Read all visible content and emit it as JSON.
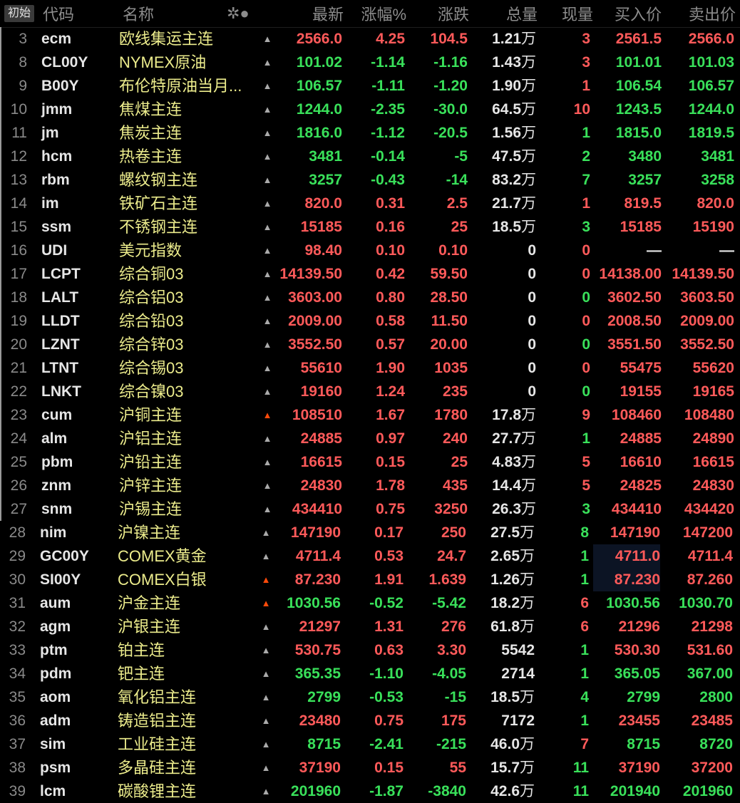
{
  "toolbar": {
    "init_label": "初始",
    "sort_icon": "✲●"
  },
  "header": {
    "code": "代码",
    "name": "名称",
    "last": "最新",
    "pct": "涨幅%",
    "chg": "涨跌",
    "vol": "总量",
    "cur": "现量",
    "bid": "买入价",
    "ask": "卖出价"
  },
  "colors": {
    "up": "#ff5a5a",
    "down": "#39e05a",
    "name": "#ecec8c",
    "alert": "#ff4a0a"
  },
  "rows": [
    {
      "idx": "3",
      "code": "ecm",
      "name": "欧线集运主连",
      "bell": "normal",
      "last": "2566.0",
      "pct": "4.25",
      "chg": "104.5",
      "vol": "1.21",
      "vol_unit": "万",
      "cur": "3",
      "bid": "2561.5",
      "ask": "2566.0",
      "tone": "up",
      "cur_tone": "up",
      "bid_tone": "up",
      "ask_tone": "up"
    },
    {
      "idx": "8",
      "code": "CL00Y",
      "name": "NYMEX原油",
      "bell": "normal",
      "last": "101.02",
      "pct": "-1.14",
      "chg": "-1.16",
      "vol": "1.43",
      "vol_unit": "万",
      "cur": "3",
      "bid": "101.01",
      "ask": "101.03",
      "tone": "down",
      "cur_tone": "up",
      "bid_tone": "down",
      "ask_tone": "down"
    },
    {
      "idx": "9",
      "code": "B00Y",
      "name": "布伦特原油当月...",
      "bell": "normal",
      "last": "106.57",
      "pct": "-1.11",
      "chg": "-1.20",
      "vol": "1.90",
      "vol_unit": "万",
      "cur": "1",
      "bid": "106.54",
      "ask": "106.57",
      "tone": "down",
      "cur_tone": "up",
      "bid_tone": "down",
      "ask_tone": "down"
    },
    {
      "idx": "10",
      "code": "jmm",
      "name": "焦煤主连",
      "bell": "normal",
      "last": "1244.0",
      "pct": "-2.35",
      "chg": "-30.0",
      "vol": "64.5",
      "vol_unit": "万",
      "cur": "10",
      "bid": "1243.5",
      "ask": "1244.0",
      "tone": "down",
      "cur_tone": "up",
      "bid_tone": "down",
      "ask_tone": "down"
    },
    {
      "idx": "11",
      "code": "jm",
      "name": "焦炭主连",
      "bell": "normal",
      "last": "1816.0",
      "pct": "-1.12",
      "chg": "-20.5",
      "vol": "1.56",
      "vol_unit": "万",
      "cur": "1",
      "bid": "1815.0",
      "ask": "1819.5",
      "tone": "down",
      "cur_tone": "down",
      "bid_tone": "down",
      "ask_tone": "down"
    },
    {
      "idx": "12",
      "code": "hcm",
      "name": "热卷主连",
      "bell": "normal",
      "last": "3481",
      "pct": "-0.14",
      "chg": "-5",
      "vol": "47.5",
      "vol_unit": "万",
      "cur": "2",
      "bid": "3480",
      "ask": "3481",
      "tone": "down",
      "cur_tone": "down",
      "bid_tone": "down",
      "ask_tone": "down"
    },
    {
      "idx": "13",
      "code": "rbm",
      "name": "螺纹钢主连",
      "bell": "normal",
      "last": "3257",
      "pct": "-0.43",
      "chg": "-14",
      "vol": "83.2",
      "vol_unit": "万",
      "cur": "7",
      "bid": "3257",
      "ask": "3258",
      "tone": "down",
      "cur_tone": "down",
      "bid_tone": "down",
      "ask_tone": "down"
    },
    {
      "idx": "14",
      "code": "im",
      "name": "铁矿石主连",
      "bell": "normal",
      "last": "820.0",
      "pct": "0.31",
      "chg": "2.5",
      "vol": "21.7",
      "vol_unit": "万",
      "cur": "1",
      "bid": "819.5",
      "ask": "820.0",
      "tone": "up",
      "cur_tone": "up",
      "bid_tone": "up",
      "ask_tone": "up"
    },
    {
      "idx": "15",
      "code": "ssm",
      "name": "不锈钢主连",
      "bell": "normal",
      "last": "15185",
      "pct": "0.16",
      "chg": "25",
      "vol": "18.5",
      "vol_unit": "万",
      "cur": "3",
      "bid": "15185",
      "ask": "15190",
      "tone": "up",
      "cur_tone": "down",
      "bid_tone": "up",
      "ask_tone": "up"
    },
    {
      "idx": "16",
      "code": "UDI",
      "name": "美元指数",
      "bell": "normal",
      "last": "98.40",
      "pct": "0.10",
      "chg": "0.10",
      "vol": "0",
      "vol_unit": "",
      "cur": "0",
      "bid": "—",
      "ask": "—",
      "tone": "up",
      "cur_tone": "up",
      "bid_tone": "flat",
      "ask_tone": "flat"
    },
    {
      "idx": "17",
      "code": "LCPT",
      "name": "综合铜03",
      "bell": "normal",
      "last": "14139.50",
      "pct": "0.42",
      "chg": "59.50",
      "vol": "0",
      "vol_unit": "",
      "cur": "0",
      "bid": "14138.00",
      "ask": "14139.50",
      "tone": "up",
      "cur_tone": "up",
      "bid_tone": "up",
      "ask_tone": "up"
    },
    {
      "idx": "18",
      "code": "LALT",
      "name": "综合铝03",
      "bell": "normal",
      "last": "3603.00",
      "pct": "0.80",
      "chg": "28.50",
      "vol": "0",
      "vol_unit": "",
      "cur": "0",
      "bid": "3602.50",
      "ask": "3603.50",
      "tone": "up",
      "cur_tone": "down",
      "bid_tone": "up",
      "ask_tone": "up"
    },
    {
      "idx": "19",
      "code": "LLDT",
      "name": "综合铅03",
      "bell": "normal",
      "last": "2009.00",
      "pct": "0.58",
      "chg": "11.50",
      "vol": "0",
      "vol_unit": "",
      "cur": "0",
      "bid": "2008.50",
      "ask": "2009.00",
      "tone": "up",
      "cur_tone": "up",
      "bid_tone": "up",
      "ask_tone": "up"
    },
    {
      "idx": "20",
      "code": "LZNT",
      "name": "综合锌03",
      "bell": "normal",
      "last": "3552.50",
      "pct": "0.57",
      "chg": "20.00",
      "vol": "0",
      "vol_unit": "",
      "cur": "0",
      "bid": "3551.50",
      "ask": "3552.50",
      "tone": "up",
      "cur_tone": "down",
      "bid_tone": "up",
      "ask_tone": "up"
    },
    {
      "idx": "21",
      "code": "LTNT",
      "name": "综合锡03",
      "bell": "normal",
      "last": "55610",
      "pct": "1.90",
      "chg": "1035",
      "vol": "0",
      "vol_unit": "",
      "cur": "0",
      "bid": "55475",
      "ask": "55620",
      "tone": "up",
      "cur_tone": "up",
      "bid_tone": "up",
      "ask_tone": "up"
    },
    {
      "idx": "22",
      "code": "LNKT",
      "name": "综合镍03",
      "bell": "normal",
      "last": "19160",
      "pct": "1.24",
      "chg": "235",
      "vol": "0",
      "vol_unit": "",
      "cur": "0",
      "bid": "19155",
      "ask": "19165",
      "tone": "up",
      "cur_tone": "down",
      "bid_tone": "up",
      "ask_tone": "up"
    },
    {
      "idx": "23",
      "code": "cum",
      "name": "沪铜主连",
      "bell": "active",
      "last": "108510",
      "pct": "1.67",
      "chg": "1780",
      "vol": "17.8",
      "vol_unit": "万",
      "cur": "9",
      "bid": "108460",
      "ask": "108480",
      "tone": "up",
      "cur_tone": "up",
      "bid_tone": "up",
      "ask_tone": "up"
    },
    {
      "idx": "24",
      "code": "alm",
      "name": "沪铝主连",
      "bell": "normal",
      "last": "24885",
      "pct": "0.97",
      "chg": "240",
      "vol": "27.7",
      "vol_unit": "万",
      "cur": "1",
      "bid": "24885",
      "ask": "24890",
      "tone": "up",
      "cur_tone": "down",
      "bid_tone": "up",
      "ask_tone": "up"
    },
    {
      "idx": "25",
      "code": "pbm",
      "name": "沪铅主连",
      "bell": "normal",
      "last": "16615",
      "pct": "0.15",
      "chg": "25",
      "vol": "4.83",
      "vol_unit": "万",
      "cur": "5",
      "bid": "16610",
      "ask": "16615",
      "tone": "up",
      "cur_tone": "up",
      "bid_tone": "up",
      "ask_tone": "up"
    },
    {
      "idx": "26",
      "code": "znm",
      "name": "沪锌主连",
      "bell": "normal",
      "last": "24830",
      "pct": "1.78",
      "chg": "435",
      "vol": "14.4",
      "vol_unit": "万",
      "cur": "5",
      "bid": "24825",
      "ask": "24830",
      "tone": "up",
      "cur_tone": "up",
      "bid_tone": "up",
      "ask_tone": "up"
    },
    {
      "idx": "27",
      "code": "snm",
      "name": "沪锡主连",
      "bell": "normal",
      "last": "434410",
      "pct": "0.75",
      "chg": "3250",
      "vol": "26.3",
      "vol_unit": "万",
      "cur": "3",
      "bid": "434410",
      "ask": "434420",
      "tone": "up",
      "cur_tone": "down",
      "bid_tone": "up",
      "ask_tone": "up"
    },
    {
      "idx": "28",
      "code": "nim",
      "name": "沪镍主连",
      "bell": "normal",
      "last": "147190",
      "pct": "0.17",
      "chg": "250",
      "vol": "27.5",
      "vol_unit": "万",
      "cur": "8",
      "bid": "147190",
      "ask": "147200",
      "tone": "up",
      "cur_tone": "down",
      "bid_tone": "up",
      "ask_tone": "up"
    },
    {
      "idx": "29",
      "code": "GC00Y",
      "name": "COMEX黄金",
      "bell": "normal",
      "last": "4711.4",
      "pct": "0.53",
      "chg": "24.7",
      "vol": "2.65",
      "vol_unit": "万",
      "cur": "1",
      "bid": "4711.0",
      "ask": "4711.4",
      "tone": "up",
      "cur_tone": "down",
      "bid_tone": "up",
      "ask_tone": "up",
      "bid_hl": true
    },
    {
      "idx": "30",
      "code": "SI00Y",
      "name": "COMEX白银",
      "bell": "active",
      "last": "87.230",
      "pct": "1.91",
      "chg": "1.639",
      "vol": "1.26",
      "vol_unit": "万",
      "cur": "1",
      "bid": "87.230",
      "ask": "87.260",
      "tone": "up",
      "cur_tone": "down",
      "bid_tone": "up",
      "ask_tone": "up",
      "bid_hl": true
    },
    {
      "idx": "31",
      "code": "aum",
      "name": "沪金主连",
      "bell": "active",
      "last": "1030.56",
      "pct": "-0.52",
      "chg": "-5.42",
      "vol": "18.2",
      "vol_unit": "万",
      "cur": "6",
      "bid": "1030.56",
      "ask": "1030.70",
      "tone": "down",
      "cur_tone": "up",
      "bid_tone": "down",
      "ask_tone": "down"
    },
    {
      "idx": "32",
      "code": "agm",
      "name": "沪银主连",
      "bell": "normal",
      "last": "21297",
      "pct": "1.31",
      "chg": "276",
      "vol": "61.8",
      "vol_unit": "万",
      "cur": "6",
      "bid": "21296",
      "ask": "21298",
      "tone": "up",
      "cur_tone": "up",
      "bid_tone": "up",
      "ask_tone": "up"
    },
    {
      "idx": "33",
      "code": "ptm",
      "name": "铂主连",
      "bell": "normal",
      "last": "530.75",
      "pct": "0.63",
      "chg": "3.30",
      "vol": "5542",
      "vol_unit": "",
      "cur": "1",
      "bid": "530.30",
      "ask": "531.60",
      "tone": "up",
      "cur_tone": "down",
      "bid_tone": "up",
      "ask_tone": "up"
    },
    {
      "idx": "34",
      "code": "pdm",
      "name": "钯主连",
      "bell": "normal",
      "last": "365.35",
      "pct": "-1.10",
      "chg": "-4.05",
      "vol": "2714",
      "vol_unit": "",
      "cur": "1",
      "bid": "365.05",
      "ask": "367.00",
      "tone": "down",
      "cur_tone": "down",
      "bid_tone": "down",
      "ask_tone": "down"
    },
    {
      "idx": "35",
      "code": "aom",
      "name": "氧化铝主连",
      "bell": "normal",
      "last": "2799",
      "pct": "-0.53",
      "chg": "-15",
      "vol": "18.5",
      "vol_unit": "万",
      "cur": "4",
      "bid": "2799",
      "ask": "2800",
      "tone": "down",
      "cur_tone": "down",
      "bid_tone": "down",
      "ask_tone": "down"
    },
    {
      "idx": "36",
      "code": "adm",
      "name": "铸造铝主连",
      "bell": "normal",
      "last": "23480",
      "pct": "0.75",
      "chg": "175",
      "vol": "7172",
      "vol_unit": "",
      "cur": "1",
      "bid": "23455",
      "ask": "23485",
      "tone": "up",
      "cur_tone": "down",
      "bid_tone": "up",
      "ask_tone": "up"
    },
    {
      "idx": "37",
      "code": "sim",
      "name": "工业硅主连",
      "bell": "normal",
      "last": "8715",
      "pct": "-2.41",
      "chg": "-215",
      "vol": "46.0",
      "vol_unit": "万",
      "cur": "7",
      "bid": "8715",
      "ask": "8720",
      "tone": "down",
      "cur_tone": "up",
      "bid_tone": "down",
      "ask_tone": "down"
    },
    {
      "idx": "38",
      "code": "psm",
      "name": "多晶硅主连",
      "bell": "normal",
      "last": "37190",
      "pct": "0.15",
      "chg": "55",
      "vol": "15.7",
      "vol_unit": "万",
      "cur": "11",
      "bid": "37190",
      "ask": "37200",
      "tone": "up",
      "cur_tone": "down",
      "bid_tone": "up",
      "ask_tone": "up"
    },
    {
      "idx": "39",
      "code": "lcm",
      "name": "碳酸锂主连",
      "bell": "normal",
      "last": "201960",
      "pct": "-1.87",
      "chg": "-3840",
      "vol": "42.6",
      "vol_unit": "万",
      "cur": "11",
      "bid": "201940",
      "ask": "201960",
      "tone": "down",
      "cur_tone": "down",
      "bid_tone": "down",
      "ask_tone": "down"
    }
  ]
}
